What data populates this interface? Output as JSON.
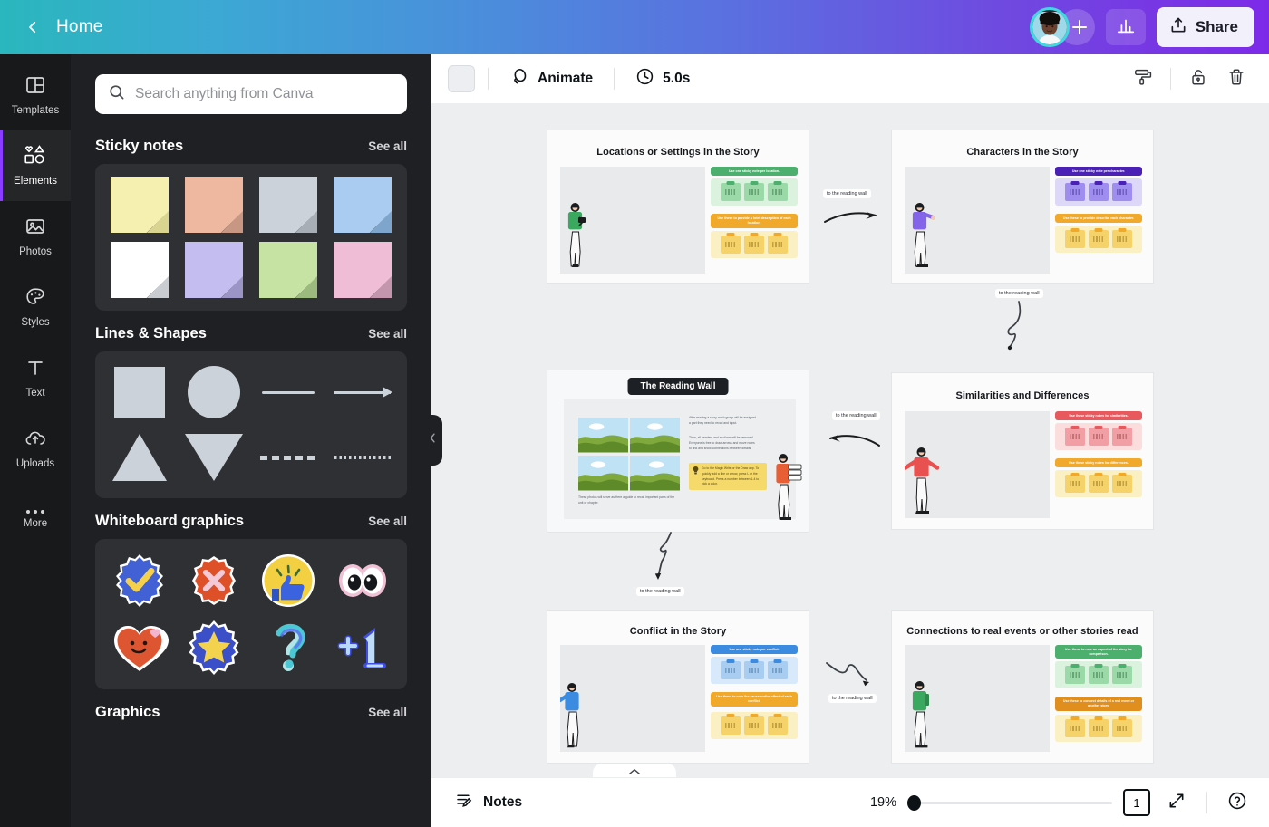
{
  "header": {
    "back_icon": "chevron-left-icon",
    "home_label": "Home",
    "avatar_name": "user-avatar",
    "add_collaborator_icon": "plus-icon",
    "analytics_icon": "bar-chart-icon",
    "share_icon": "share-upload-icon",
    "share_label": "Share",
    "gradient_from": "#2ab7bd",
    "gradient_to": "#7d2ae8"
  },
  "rail": {
    "items": [
      {
        "label": "Templates",
        "icon": "templates-icon",
        "active": false
      },
      {
        "label": "Elements",
        "icon": "elements-icon",
        "active": true
      },
      {
        "label": "Photos",
        "icon": "photos-icon",
        "active": false
      },
      {
        "label": "Styles",
        "icon": "styles-palette-icon",
        "active": false
      },
      {
        "label": "Text",
        "icon": "text-icon",
        "active": false
      },
      {
        "label": "Uploads",
        "icon": "uploads-cloud-icon",
        "active": false
      },
      {
        "label": "More",
        "icon": "more-dots-icon",
        "active": false
      }
    ]
  },
  "panel": {
    "search": {
      "placeholder": "Search anything from Canva",
      "value": "",
      "icon": "search-icon"
    },
    "see_all_label": "See all",
    "sections": [
      {
        "title": "Sticky notes",
        "kind": "sticky",
        "items": [
          {
            "name": "sticky-note-yellow",
            "color": "#f5f0b0"
          },
          {
            "name": "sticky-note-peach",
            "color": "#eeb79f"
          },
          {
            "name": "sticky-note-gray",
            "color": "#ccd2da"
          },
          {
            "name": "sticky-note-blue",
            "color": "#a9ccf0"
          },
          {
            "name": "sticky-note-white",
            "color": "#ffffff"
          },
          {
            "name": "sticky-note-purple",
            "color": "#c4bdf0"
          },
          {
            "name": "sticky-note-green",
            "color": "#c6e3a3"
          },
          {
            "name": "sticky-note-pink",
            "color": "#f0bdd6"
          }
        ]
      },
      {
        "title": "Lines & Shapes",
        "kind": "shapes",
        "items": [
          {
            "name": "shape-square",
            "glyph": "square"
          },
          {
            "name": "shape-circle",
            "glyph": "circle"
          },
          {
            "name": "line-straight",
            "glyph": "line"
          },
          {
            "name": "line-arrow",
            "glyph": "arrow"
          },
          {
            "name": "shape-triangle-up",
            "glyph": "triangle-up"
          },
          {
            "name": "shape-triangle-down",
            "glyph": "triangle-down"
          },
          {
            "name": "line-dashed",
            "glyph": "dashed"
          },
          {
            "name": "line-dotted",
            "glyph": "dotted"
          }
        ]
      },
      {
        "title": "Whiteboard graphics",
        "kind": "stickers",
        "items": [
          {
            "name": "sticker-check-badge",
            "glyph": "check"
          },
          {
            "name": "sticker-cross-badge",
            "glyph": "cross"
          },
          {
            "name": "sticker-thumbs-up",
            "glyph": "thumbsup"
          },
          {
            "name": "sticker-eyes",
            "glyph": "eyes"
          },
          {
            "name": "sticker-smiley-heart",
            "glyph": "heart"
          },
          {
            "name": "sticker-star-badge",
            "glyph": "star"
          },
          {
            "name": "sticker-question-mark",
            "glyph": "question"
          },
          {
            "name": "sticker-plus-one",
            "glyph": "plusone"
          }
        ]
      },
      {
        "title": "Graphics",
        "kind": "header-only",
        "items": []
      }
    ],
    "collapse_icon": "chevron-left-icon"
  },
  "toolbar": {
    "color_swatch": "#eceef1",
    "animate_icon": "animate-icon",
    "animate_label": "Animate",
    "timer_icon": "clock-icon",
    "duration_label": "5.0s",
    "right_icons": [
      {
        "name": "paint-roller-icon"
      },
      {
        "name": "lock-open-icon"
      },
      {
        "name": "trash-icon"
      }
    ]
  },
  "canvas": {
    "background": "#eceef0",
    "cards": [
      {
        "id": "card-locations",
        "title": "Locations or Settings in the Story",
        "accent_primary": "#4caf6d",
        "accent_secondary": "#f0a92b",
        "tray_primary": "#daf2de",
        "tray_secondary": "#fbefc4",
        "note_primary": "#9bd9a8",
        "note_secondary": "#f5d36a",
        "figure": "person-green-tablet",
        "banner_primary": "Use one sticky note per location.",
        "banner_secondary": "Use these to provide a brief description of each location."
      },
      {
        "id": "card-characters",
        "title": "Characters in the Story",
        "accent_primary": "#4a20b5",
        "accent_secondary": "#f0a92b",
        "tray_primary": "#ddd8f7",
        "tray_secondary": "#fbefc4",
        "note_primary": "#9f8ef0",
        "note_secondary": "#f5d36a",
        "figure": "person-purple-pointing",
        "banner_primary": "Use one sticky note per character.",
        "banner_secondary": "Use these to provide describe each character."
      },
      {
        "id": "card-reading-wall",
        "title": "The Reading Wall",
        "is_reading_wall": true,
        "body_paragraph_1": "After reading a story, each group will be assigned a part they need to recall and input.",
        "body_paragraph_2": "Then, all headers and sections will be removed. Everyone is free to draw arrows and move notes to find and show connections between details.",
        "tip_text": "Go to the Magic Write or the Draw app. To quickly add a line or arrow, press L or the keyboard. Press a number between 1-4 to pick a color.",
        "photo_caption": "These photos will serve as Here a guide to recall important parts of the unit or chapter.",
        "tip_icon": "lightbulb-icon",
        "figure": "person-orange-books"
      },
      {
        "id": "card-similarities",
        "title": "Similarities and Differences",
        "accent_primary": "#e8595e",
        "accent_secondary": "#f0a92b",
        "tray_primary": "#fadddc",
        "tray_secondary": "#fbefc4",
        "note_primary": "#f19fa4",
        "note_secondary": "#f5d36a",
        "figure": "person-red-arms-out",
        "banner_primary": "Use these sticky notes for similarities.",
        "banner_secondary": "Use these sticky notes for differences."
      },
      {
        "id": "card-conflict",
        "title": "Conflict in the Story",
        "accent_primary": "#3b8ce0",
        "accent_secondary": "#f0a92b",
        "tray_primary": "#d7e9fa",
        "tray_secondary": "#fbefc4",
        "note_primary": "#a8cdf0",
        "note_secondary": "#f5d36a",
        "figure": "person-blue-leaning",
        "banner_primary": "Use one sticky note per conflict.",
        "banner_secondary": "Use these to note the cause and/or effect of each conflict."
      },
      {
        "id": "card-connections",
        "title": "Connections to real events or other stories read",
        "accent_primary": "#4caf6d",
        "accent_secondary": "#e08f1f",
        "tray_primary": "#daf2de",
        "tray_secondary": "#fbefc4",
        "note_primary": "#9bd9a8",
        "note_secondary": "#f5d36a",
        "figure": "person-green-backpack",
        "banner_primary": "Use these to note an aspect of the story for comparison.",
        "banner_secondary": "Use these to connect details of a real event or another story."
      }
    ],
    "connectors": [
      {
        "id": "connector-1",
        "label": "to the reading wall",
        "direction": "right"
      },
      {
        "id": "connector-2",
        "label": "to the reading wall",
        "direction": "curve-down"
      },
      {
        "id": "connector-3",
        "label": "to the reading wall",
        "direction": "left"
      },
      {
        "id": "connector-4",
        "label": "to the reading wall",
        "direction": "squiggle-down"
      },
      {
        "id": "connector-5",
        "label": "to the reading wall",
        "direction": "squiggle-right"
      }
    ]
  },
  "bottombar": {
    "notes_icon": "notes-icon",
    "notes_label": "Notes",
    "zoom_level": "19%",
    "page_number": "1",
    "pager_icon": "page-manager-icon",
    "fullscreen_icon": "expand-icon",
    "help_icon": "help-circle-icon",
    "expand_notes_icon": "chevron-up-icon"
  }
}
